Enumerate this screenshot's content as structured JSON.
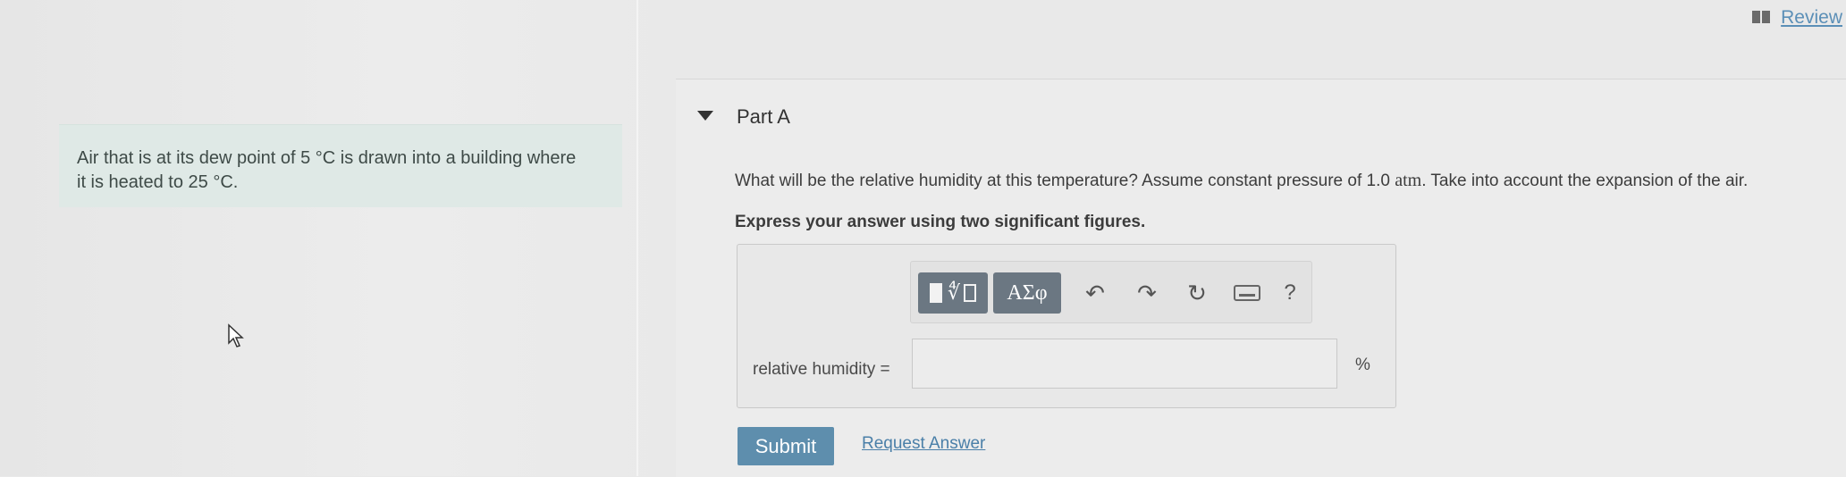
{
  "header": {
    "review_label": "Review"
  },
  "problem": {
    "text_line1": "Air that is at its dew point of 5 °C is drawn into a building where",
    "text_line2": "it is heated to 25 °C."
  },
  "part": {
    "title": "Part A",
    "question_prefix": "What will be the relative humidity at this temperature? Assume constant pressure of 1.0 ",
    "question_unit": "atm",
    "question_suffix": ". Take into account the expansion of the air.",
    "instruction": "Express your answer using two significant figures."
  },
  "toolbar": {
    "greek_label": "ΑΣφ",
    "help_label": "?"
  },
  "answer": {
    "label": "relative humidity =",
    "value": "",
    "unit": "%"
  },
  "actions": {
    "submit_label": "Submit",
    "request_label": "Request Answer"
  },
  "colors": {
    "accent": "#5e8ead",
    "link": "#4a7fa8",
    "toolbar_button": "#6b7782"
  }
}
